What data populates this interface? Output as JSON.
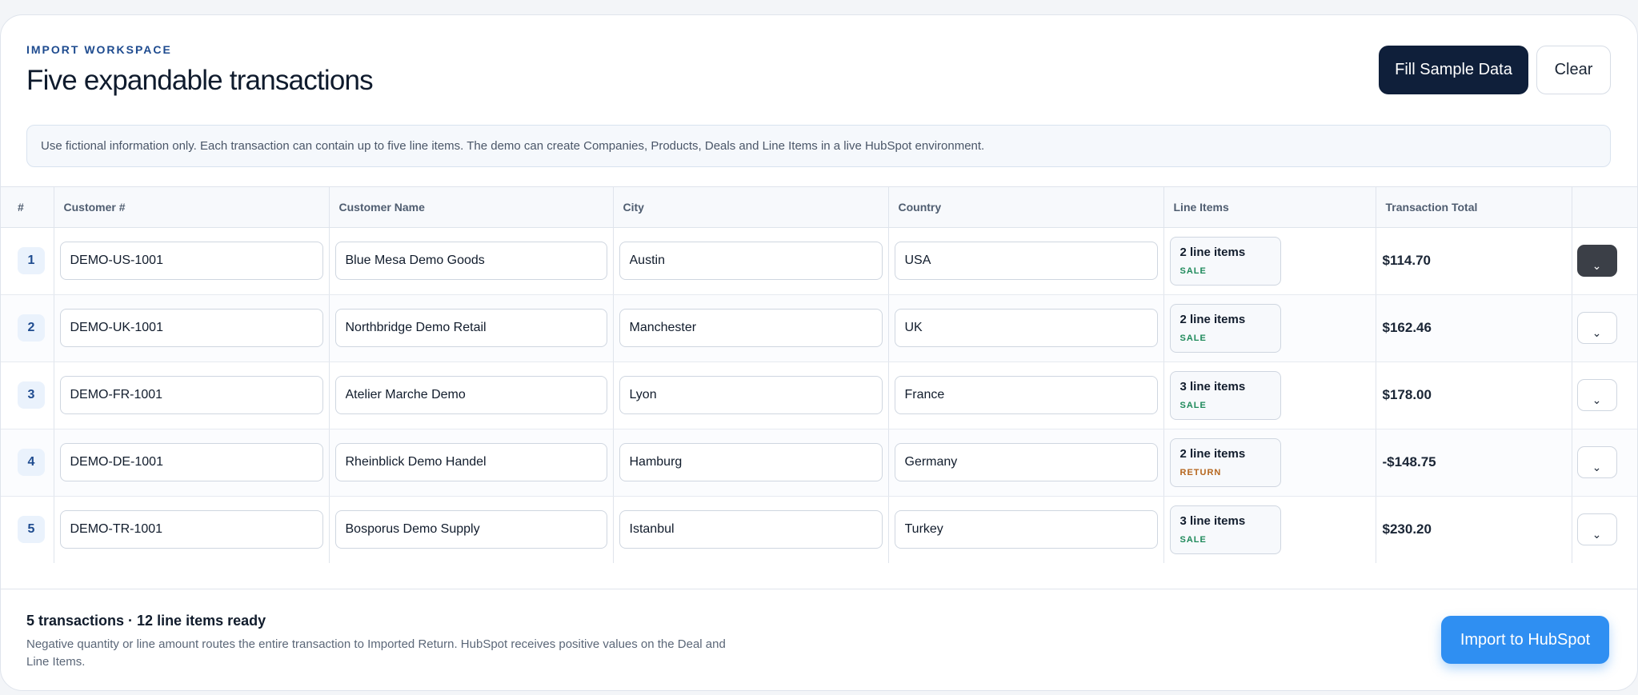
{
  "header": {
    "eyebrow": "IMPORT WORKSPACE",
    "title": "Five expandable transactions",
    "fill_label": "Fill Sample Data",
    "clear_label": "Clear"
  },
  "notice": "Use fictional information only. Each transaction can contain up to five line items. The demo can create Companies, Products, Deals and Line Items in a live HubSpot environment.",
  "table": {
    "columns": [
      "#",
      "Customer #",
      "Customer Name",
      "City",
      "Country",
      "Line Items",
      "Transaction Total",
      ""
    ],
    "rows": [
      {
        "index": "1",
        "customer_no": "DEMO-US-1001",
        "customer_name": "Blue Mesa Demo Goods",
        "city": "Austin",
        "country": "USA",
        "line_items": "2 line items",
        "type": "SALE",
        "total": "$114.70",
        "expand_icon": "chevron-down",
        "expanded": true
      },
      {
        "index": "2",
        "customer_no": "DEMO-UK-1001",
        "customer_name": "Northbridge Demo Retail",
        "city": "Manchester",
        "country": "UK",
        "line_items": "2 line items",
        "type": "SALE",
        "total": "$162.46",
        "expand_icon": "chevron-down",
        "expanded": false
      },
      {
        "index": "3",
        "customer_no": "DEMO-FR-1001",
        "customer_name": "Atelier Marche Demo",
        "city": "Lyon",
        "country": "France",
        "line_items": "3 line items",
        "type": "SALE",
        "total": "$178.00",
        "expand_icon": "chevron-down",
        "expanded": false
      },
      {
        "index": "4",
        "customer_no": "DEMO-DE-1001",
        "customer_name": "Rheinblick Demo Handel",
        "city": "Hamburg",
        "country": "Germany",
        "line_items": "2 line items",
        "type": "RETURN",
        "total": "-$148.75",
        "expand_icon": "chevron-down",
        "expanded": false
      },
      {
        "index": "5",
        "customer_no": "DEMO-TR-1001",
        "customer_name": "Bosporus Demo Supply",
        "city": "Istanbul",
        "country": "Turkey",
        "line_items": "3 line items",
        "type": "SALE",
        "total": "$230.20",
        "expand_icon": "chevron-down",
        "expanded": false
      }
    ]
  },
  "footer": {
    "summary": "5 transactions · 12 line items ready",
    "hint": "Negative quantity or line amount routes the entire transaction to Imported Return. HubSpot receives positive values on the Deal and Line Items.",
    "import_label": "Import to HubSpot"
  },
  "colors": {
    "accent": "#2f8ff2",
    "primary_dark": "#0f1f3a",
    "sale": "#1f8a5b",
    "return": "#b5651d"
  }
}
